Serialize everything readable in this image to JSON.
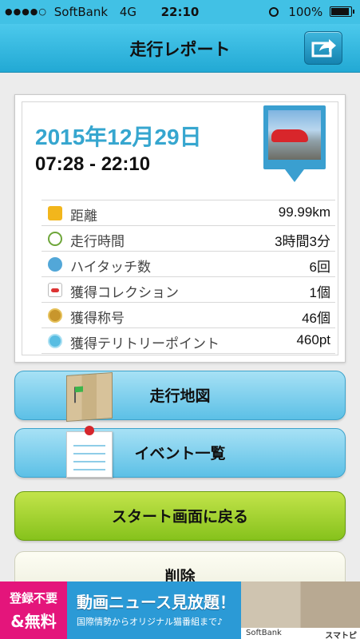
{
  "status_bar": {
    "signal": "●●●●○",
    "carrier": "SoftBank",
    "network": "4G",
    "time": "22:10",
    "battery": "100%",
    "battery_level": 1.0
  },
  "nav": {
    "title": "走行レポート",
    "share_icon": "share-arrow-icon"
  },
  "report": {
    "date": "2015年12月29日",
    "time_range": "07:28 - 22:10",
    "stats": [
      {
        "icon": "km-icon",
        "label": "距離",
        "value": "99.99km"
      },
      {
        "icon": "clock-icon",
        "label": "走行時間",
        "value": "3時間3分"
      },
      {
        "icon": "hand-icon",
        "label": "ハイタッチ数",
        "value": "6回"
      },
      {
        "icon": "car-icon",
        "label": "獲得コレクション",
        "value": "1個"
      },
      {
        "icon": "medal-icon",
        "label": "獲得称号",
        "value": "46個"
      },
      {
        "icon": "point-icon",
        "label": "獲得テリトリーポイント",
        "value": "460pt"
      }
    ]
  },
  "buttons": {
    "map": "走行地図",
    "events": "イベント一覧",
    "back_to_start": "スタート画面に戻る",
    "delete": "削除"
  },
  "ad": {
    "badge_line1": "登録不要",
    "badge_line2": "&無料",
    "headline": "動画ニュース見放題！",
    "subline": "国際情勢からオリジナル猫番組まで♪",
    "logo_softbank": "SoftBank",
    "logo_sumaho": "スマトピ"
  },
  "colors": {
    "accent": "#36a6cf",
    "nav": "#29b0dc",
    "green_button": "#9ccf2c"
  }
}
